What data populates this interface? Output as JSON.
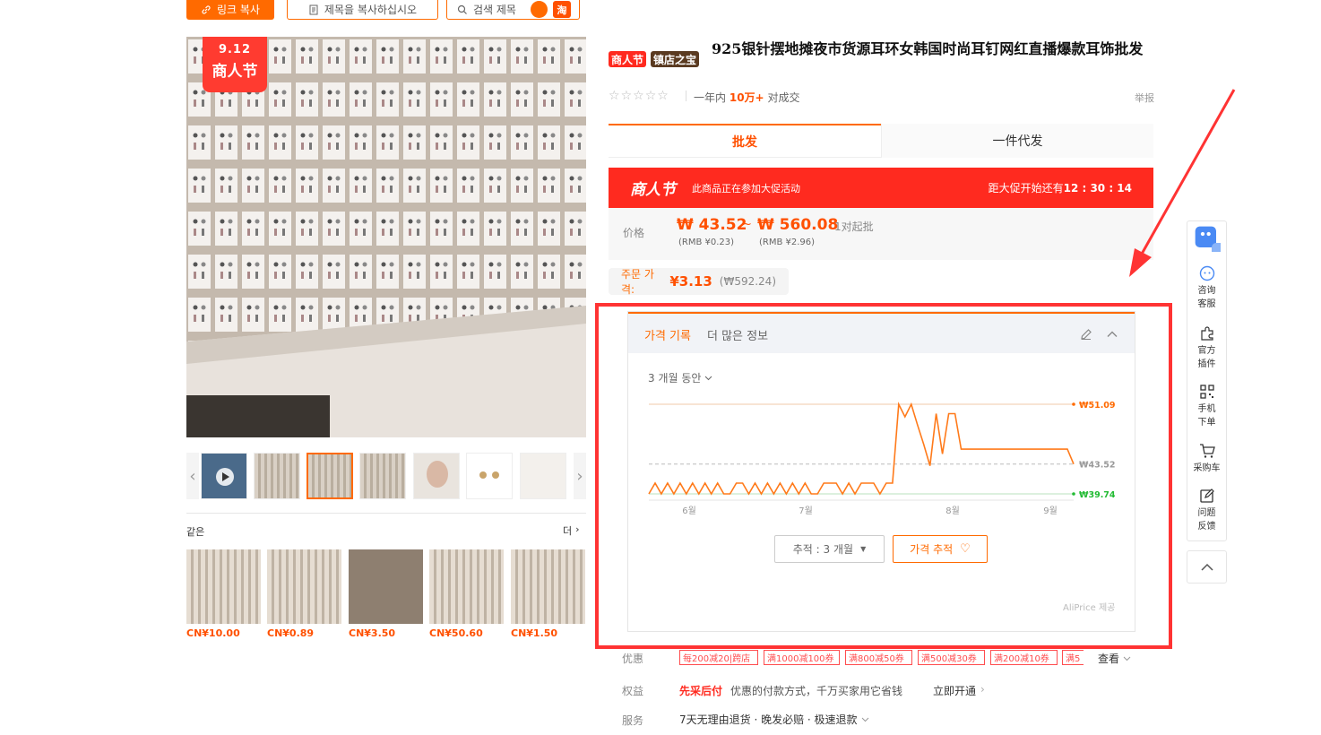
{
  "toolbar": {
    "copy_link": "링크 복사",
    "copy_title": "제목을 복사하십시오",
    "search_title": "검색 제목",
    "taobao_label": "淘"
  },
  "gallery": {
    "badge_date": "9.12",
    "badge_text": "商人节"
  },
  "similar": {
    "label": "같은",
    "more": "더",
    "prices": [
      "CN¥10.00",
      "CN¥0.89",
      "CN¥3.50",
      "CN¥50.60",
      "CN¥1.50"
    ]
  },
  "product": {
    "tag_festival": "商人节",
    "tag_shop": "镇店之宝",
    "title": "925银针摆地摊夜市货源耳环女韩国时尚耳钉网红直播爆款耳饰批发",
    "sales_prefix": "一年内",
    "sales_count": "10万+",
    "sales_suffix": "对成交",
    "report": "举报"
  },
  "tabs": {
    "wholesale": "批发",
    "dropship": "一件代发"
  },
  "promo": {
    "logo": "商人节",
    "notice": "此商品正在参加大促活动",
    "countdown_label": "距大促开始还有",
    "countdown": "12 : 30 : 14"
  },
  "price": {
    "label": "价格",
    "low": "₩ 43.52",
    "separator": "~",
    "high": "₩ 560.08",
    "moq": "1对起批",
    "low_rmb": "(RMB ¥0.23)",
    "high_rmb": "(RMB ¥2.96)"
  },
  "order_price": {
    "label": "주문 가격:",
    "value": "¥3.13",
    "krw": "(₩592.24)"
  },
  "widget": {
    "tab_history": "가격 기록",
    "tab_more": "더 많은 정보",
    "period": "3 개월 동안",
    "track_select": "추적 : 3 개월",
    "track_button": "가격 추적",
    "credit": "AliPrice 제공"
  },
  "chart_data": {
    "type": "line",
    "x_ticks": [
      "6월",
      "7월",
      "8월",
      "9월"
    ],
    "max_label": "₩51.09",
    "current_label": "₩43.52",
    "min_label": "₩39.74",
    "ylim": [
      39.74,
      51.09
    ],
    "series": [
      {
        "values": [
          39.74,
          41.1,
          39.74,
          41.1,
          39.74,
          41.1,
          39.74,
          41.1,
          39.74,
          41.1,
          39.74,
          41.1,
          39.74,
          39.74,
          41.1,
          41.1,
          39.74,
          41.1,
          39.74,
          41.1,
          39.74,
          41.1,
          39.74,
          41.1,
          39.74,
          41.1,
          39.74,
          39.74,
          41.1,
          41.1,
          41.1,
          39.74,
          41.1,
          39.74,
          41.1,
          41.1,
          41.1,
          39.74,
          41.1,
          41.1,
          51.09,
          49.5,
          51.09,
          48.5,
          46.0,
          43.3,
          49.9,
          44.8,
          49.9,
          49.9,
          45.4,
          45.4,
          45.4,
          45.4,
          45.4,
          45.4,
          45.4,
          45.4,
          45.4,
          45.4,
          45.4,
          45.4,
          45.4,
          45.4,
          45.4,
          45.4,
          45.4,
          45.4,
          43.52
        ],
        "color": "#ff7a1a"
      }
    ]
  },
  "coupons": {
    "label": "优惠",
    "items": [
      "每200减20|跨店",
      "满1000减100券",
      "满800减50券",
      "满500减30券",
      "满200减10券",
      "满5"
    ],
    "view": "查看"
  },
  "benefit": {
    "label": "权益",
    "name": "先采后付",
    "desc": "优惠的付款方式，千万买家用它省钱",
    "action": "立即开通"
  },
  "service": {
    "label": "服务",
    "desc": "7天无理由退货 · 晚发必赔 · 极速退款"
  },
  "sidebar": {
    "items": [
      "咨询客服",
      "官方插件",
      "手机下单",
      "采购车",
      "问题反馈"
    ]
  },
  "colors": {
    "accent": "#ff6a00",
    "price_red": "#ff5000",
    "promo_red": "#ff2a1f",
    "frame_red": "#ff3333",
    "min_green": "#22bb33"
  }
}
